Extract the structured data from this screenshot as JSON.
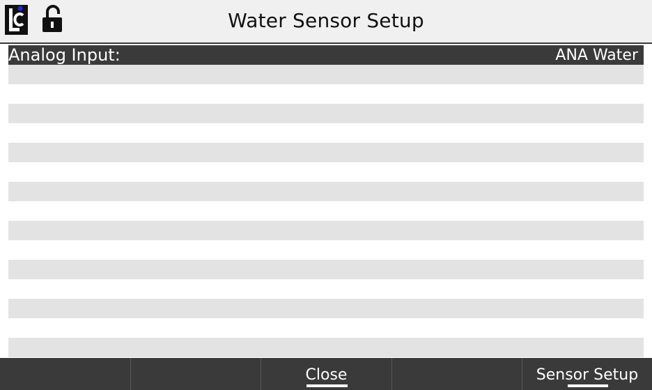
{
  "window": {
    "title": "Water Sensor Setup"
  },
  "icons": {
    "logo": "lc-logo",
    "lock": "unlocked-padlock-icon"
  },
  "colors": {
    "header_bg": "#3a3a3a",
    "row_stripe": "#e3e3e3",
    "logo_dot": "#1e2bd6"
  },
  "table": {
    "header_label": "Analog Input:",
    "header_value": "ANA Water",
    "row_count": 15
  },
  "softkeys": [
    {
      "label": ""
    },
    {
      "label": ""
    },
    {
      "label": "Close"
    },
    {
      "label": ""
    },
    {
      "label": "Sensor Setup"
    }
  ]
}
